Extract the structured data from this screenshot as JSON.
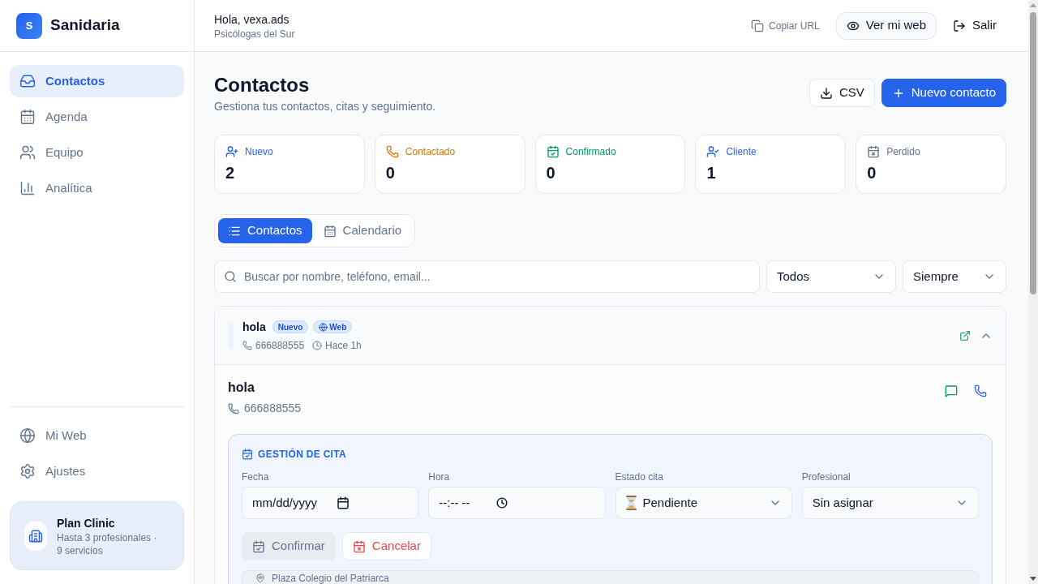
{
  "sidebar": {
    "brand": {
      "initial": "S",
      "name": "Sanidaria"
    },
    "nav": [
      {
        "label": "Contactos",
        "selected": true
      },
      {
        "label": "Agenda",
        "selected": false
      },
      {
        "label": "Equipo",
        "selected": false
      },
      {
        "label": "Analítica",
        "selected": false
      }
    ],
    "footer_nav": [
      {
        "label": "Mi Web",
        "selected": false
      },
      {
        "label": "Ajustes",
        "selected": false
      }
    ],
    "plan": {
      "name": "Plan Clinic",
      "details": "Hasta 3 profesionales · 9 servicios"
    }
  },
  "header": {
    "greeting": "Hola, vexa.ads",
    "organization": "Psicólogas del Sur",
    "actions": [
      {
        "label": "Copiar URL",
        "kind": "link"
      },
      {
        "label": "Ver mi web",
        "kind": "outlined"
      },
      {
        "label": "Salir",
        "kind": "plain"
      }
    ]
  },
  "page": {
    "title": "Contactos",
    "subtitle": "Gestiona tus contactos, citas y seguimiento.",
    "buttons": [
      {
        "label": "CSV",
        "kind": "secondary"
      },
      {
        "label": "Nuevo contacto",
        "kind": "primary"
      }
    ]
  },
  "stats": [
    {
      "label": "Nuevo",
      "count": "2",
      "color": "#2563eb"
    },
    {
      "label": "Contactado",
      "count": "0",
      "color": "#d97706"
    },
    {
      "label": "Confirmado",
      "count": "0",
      "color": "#059669"
    },
    {
      "label": "Cliente",
      "count": "1",
      "color": "#2563eb"
    },
    {
      "label": "Perdido",
      "count": "0",
      "color": "#64748b"
    }
  ],
  "view_tabs": [
    {
      "label": "Contactos",
      "selected": true
    },
    {
      "label": "Calendario",
      "selected": false
    }
  ],
  "filters": {
    "search": {
      "placeholder": "Buscar por nombre, teléfono, email..."
    },
    "selects": [
      {
        "value": "Todos"
      },
      {
        "value": "Siempre"
      }
    ]
  },
  "contacts": [
    {
      "name": "hola",
      "badges": [
        {
          "label": "Nuevo",
          "kind": "status"
        },
        {
          "label": "Web",
          "kind": "source"
        }
      ],
      "phone": "666888555",
      "time": "Hace 1h",
      "expanded": true,
      "detail": {
        "name": "hola",
        "phone": "666888555",
        "appointment": {
          "title": "GESTIÓN DE CITA",
          "fields": [
            {
              "label": "Fecha",
              "kind": "date",
              "value": "mm/dd/yyyy"
            },
            {
              "label": "Hora",
              "kind": "time",
              "value": "--:-- --"
            },
            {
              "label": "Estado cita",
              "kind": "status",
              "value": "Pendiente"
            },
            {
              "label": "Profesional",
              "kind": "select",
              "value": "Sin asignar"
            }
          ],
          "buttons": [
            {
              "label": "Confirmar",
              "kind": "confirm",
              "disabled": true
            },
            {
              "label": "Cancelar",
              "kind": "cancel",
              "disabled": false
            }
          ],
          "location": "Plaza Colegio del Patriarca"
        }
      }
    }
  ]
}
